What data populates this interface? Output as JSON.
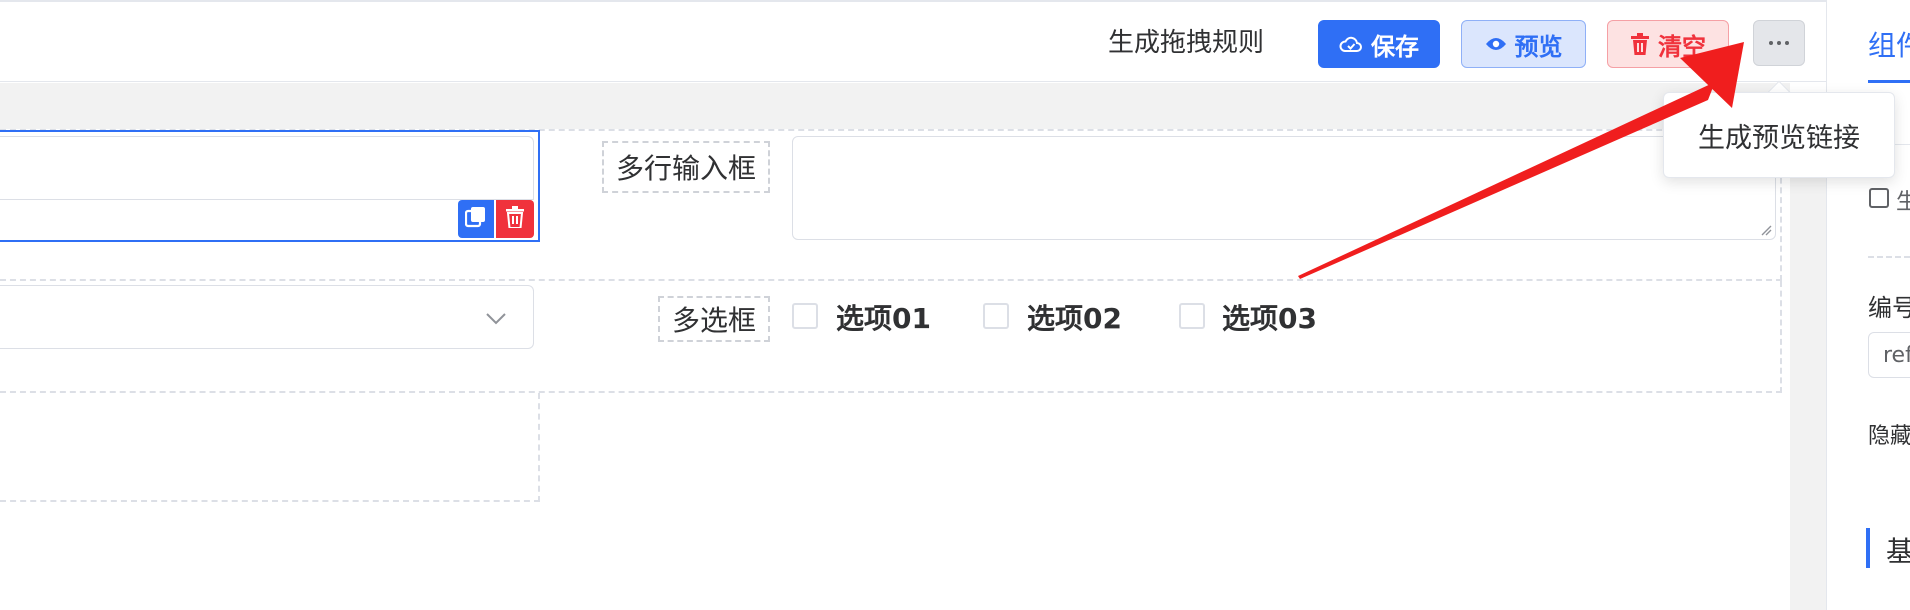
{
  "toolbar": {
    "generate_rule_link": "生成拖拽规则",
    "save_label": "保存",
    "preview_label": "预览",
    "clear_label": "清空",
    "more_tooltip": "生成预览链接"
  },
  "canvas": {
    "textarea_label": "多行输入框",
    "checkbox_label": "多选框",
    "checkbox_options": [
      "选项01",
      "选项02",
      "选项03"
    ]
  },
  "right_panel": {
    "tab_label": "组件",
    "field_label_char": "生",
    "id_label": "编号",
    "id_value": "ref",
    "hidden_label": "隐藏",
    "section_title": "基"
  },
  "colors": {
    "primary": "#2f6ff5",
    "danger": "#f0323c",
    "annotation_arrow": "#f01e1e"
  }
}
